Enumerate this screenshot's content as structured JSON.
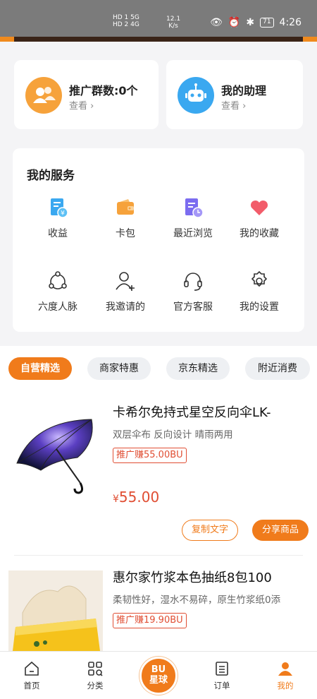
{
  "status_bar": {
    "network_left": "HD 1 5G\nHD 2 4G",
    "speed": "12.1\nK/s",
    "battery": "71",
    "time": "4:26"
  },
  "quick_cards": [
    {
      "title": "推广群数:0个",
      "action": "查看 ›"
    },
    {
      "title": "我的助理",
      "action": "查看 ›"
    }
  ],
  "services": {
    "title": "我的服务",
    "items": [
      {
        "label": "收益",
        "icon": "income-icon"
      },
      {
        "label": "卡包",
        "icon": "wallet-icon"
      },
      {
        "label": "最近浏览",
        "icon": "history-icon"
      },
      {
        "label": "我的收藏",
        "icon": "heart-icon"
      },
      {
        "label": "六度人脉",
        "icon": "network-icon"
      },
      {
        "label": "我邀请的",
        "icon": "add-user-icon"
      },
      {
        "label": "官方客服",
        "icon": "headset-icon"
      },
      {
        "label": "我的设置",
        "icon": "gear-icon"
      }
    ]
  },
  "tabs": [
    "自营精选",
    "商家特惠",
    "京东精选",
    "附近消费"
  ],
  "products": [
    {
      "title": "卡希尔免持式星空反向伞LK-",
      "desc": "双层伞布  反向设计  晴雨两用",
      "badge": "推广赚55.00BU",
      "currency": "¥",
      "price": "55.00",
      "copy_label": "复制文字",
      "share_label": "分享商品"
    },
    {
      "title": "惠尔家竹浆本色抽纸8包100",
      "desc": "柔韧性好，湿水不易碎，原生竹浆纸0添",
      "badge": "推广赚19.90BU"
    }
  ],
  "bottom_nav": [
    {
      "label": "首页",
      "icon": "home-icon"
    },
    {
      "label": "分类",
      "icon": "category-icon"
    },
    {
      "label": "订单",
      "icon": "order-icon"
    },
    {
      "label": "我的",
      "icon": "profile-icon"
    }
  ],
  "center_button": {
    "line1": "BU",
    "line2": "星球"
  },
  "colors": {
    "accent": "#f07b1b",
    "price": "#e04e33"
  }
}
